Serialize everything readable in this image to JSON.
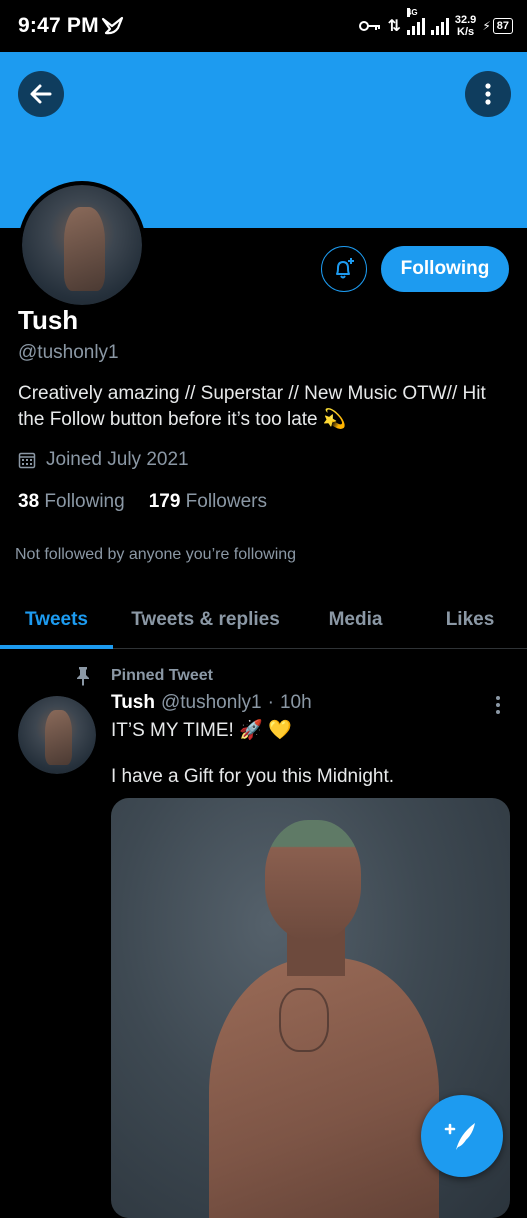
{
  "status_bar": {
    "time": "9:47 PM",
    "network_type": "4G",
    "speed_value": "32.9",
    "speed_unit": "K/s",
    "battery": "87"
  },
  "header": {
    "back_icon": "arrow-left-icon",
    "more_icon": "more-vertical-icon",
    "banner_color": "#1d9bf0"
  },
  "profile": {
    "name": "Tush",
    "handle": "@tushonly1",
    "bio": "Creatively amazing // Superstar // New Music OTW// Hit the Follow button before it’s too late 💫",
    "joined": "Joined July 2021",
    "following_count": "38",
    "following_label": "Following",
    "followers_count": "179",
    "followers_label": "Followers",
    "not_followed_text": "Not followed by anyone you’re following",
    "follow_button_label": "Following"
  },
  "tabs": [
    {
      "label": "Tweets",
      "active": true
    },
    {
      "label": "Tweets & replies",
      "active": false
    },
    {
      "label": "Media",
      "active": false
    },
    {
      "label": "Likes",
      "active": false
    }
  ],
  "tweet": {
    "pinned_label": "Pinned Tweet",
    "author_name": "Tush",
    "author_handle": "@tushonly1",
    "separator": "·",
    "time": "10h",
    "line1": "IT’S MY TIME! 🚀 💛",
    "line2": "I have a Gift for you this Midnight."
  },
  "colors": {
    "accent": "#1d9bf0",
    "background": "#000000",
    "secondary_text": "#8b98a5"
  }
}
